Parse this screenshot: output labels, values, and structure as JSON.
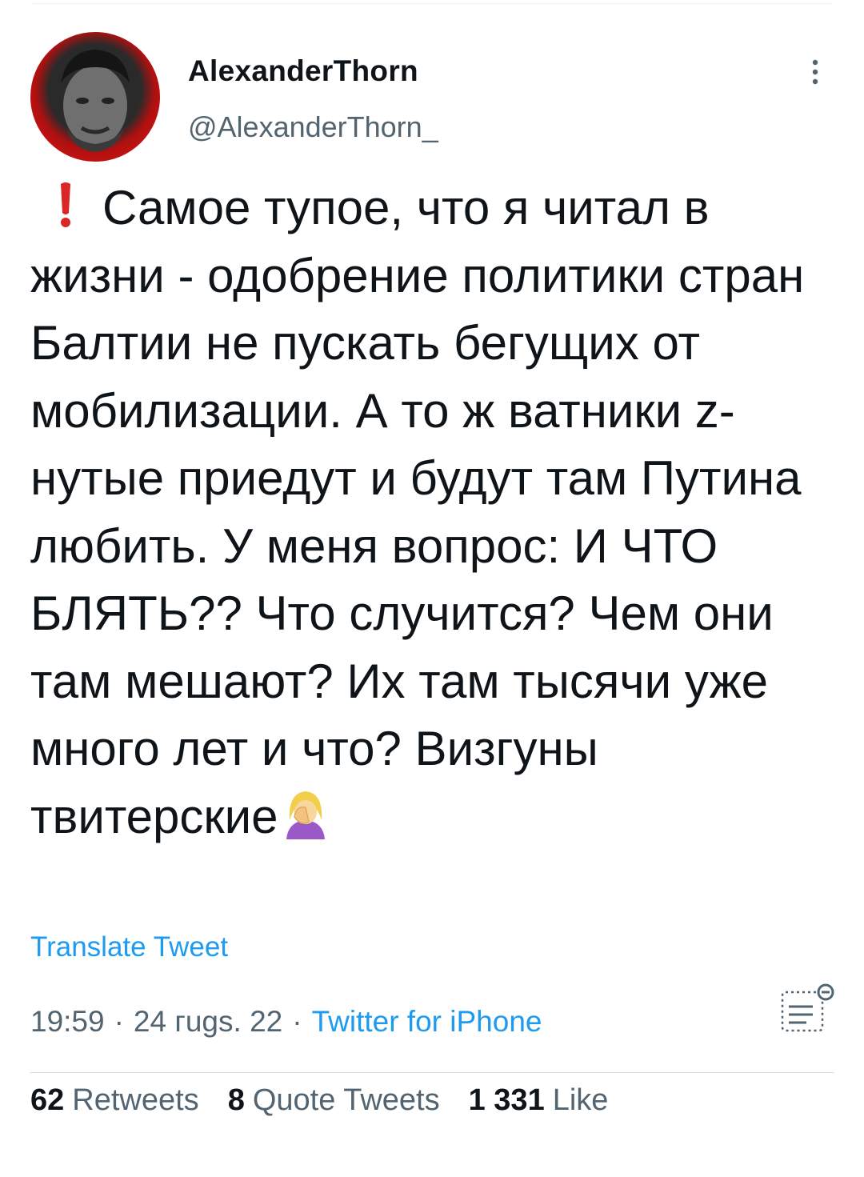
{
  "author": {
    "display_name": "AlexanderThorn",
    "handle": "@AlexanderThorn_",
    "avatar_colors": {
      "ring": "#e01818",
      "face": "#2a2a2a"
    }
  },
  "tweet": {
    "leading_icon": "red-exclamation-icon",
    "text": "Самое тупое, что я читал в жизни - одобрение политики стран Балтии не пускать бегущих от мобилизации. А то ж ватники z-нутые приедут и будут там Путина любить. У меня вопрос: И ЧТО БЛЯТЬ?? Что случится? Чем они там мешают? Их там тысячи уже много лет и что? Визгуны твитерские",
    "trailing_icon": "woman-facepalming-icon"
  },
  "translate_label": "Translate Tweet",
  "meta": {
    "time": "19:59",
    "date": "24 гugs. 22",
    "separator": "·",
    "source": "Twitter for iPhone"
  },
  "stats": [
    {
      "count": "62",
      "label": "Retweets"
    },
    {
      "count": "8",
      "label": "Quote Tweets"
    },
    {
      "count": "1 331",
      "label": "Like"
    }
  ],
  "colors": {
    "link": "#1d9bf0",
    "secondary_text": "#536471",
    "primary_text": "#0f1419",
    "divider": "#cfd9de"
  }
}
